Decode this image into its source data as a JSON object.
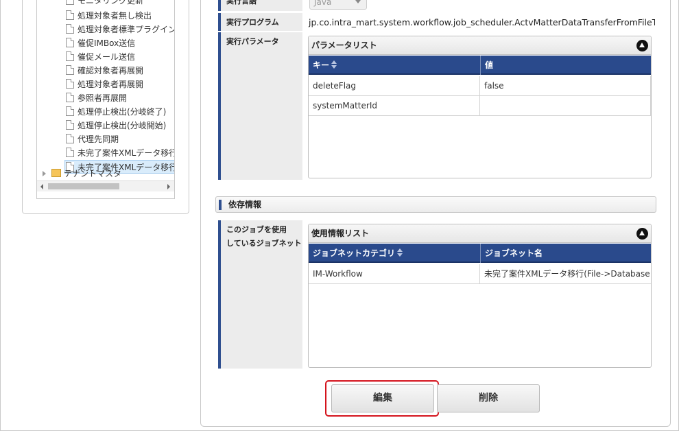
{
  "tree": {
    "items": [
      {
        "label": "モニタリング更新"
      },
      {
        "label": "処理対象者無し検出"
      },
      {
        "label": "処理対象者標準プラグイン用"
      },
      {
        "label": "催促IMBox送信"
      },
      {
        "label": "催促メール送信"
      },
      {
        "label": "確認対象者再展開"
      },
      {
        "label": "処理対象者再展開"
      },
      {
        "label": "参照者再展開"
      },
      {
        "label": "処理停止検出(分岐終了)"
      },
      {
        "label": "処理停止検出(分岐開始)"
      },
      {
        "label": "代理先同期"
      },
      {
        "label": "未完了案件XMLデータ移行"
      },
      {
        "label": "未完了案件XMLデータ移行"
      }
    ],
    "root_label": "テナントマスタ"
  },
  "job": {
    "lang_label": "実行言語",
    "lang_value": "Java",
    "program_label": "実行プログラム",
    "program_value": "jp.co.intra_mart.system.workflow.job_scheduler.ActvMatterDataTransferFromFileToDB",
    "param_label": "実行パラメータ"
  },
  "param_grid": {
    "title": "パラメータリスト",
    "columns": [
      "キー",
      "値"
    ],
    "rows": [
      [
        "deleteFlag",
        "false"
      ],
      [
        "systemMatterId",
        ""
      ]
    ]
  },
  "dependency": {
    "section_title": "依存情報",
    "net_label": "このジョブを使用しているジョブネット",
    "grid_title": "使用情報リスト",
    "columns": [
      "ジョブネットカテゴリ",
      "ジョブネット名"
    ],
    "rows": [
      [
        "IM-Workflow",
        "未完了案件XMLデータ移行(File->Database LO"
      ]
    ]
  },
  "buttons": {
    "edit_label": "編集",
    "delete_label": "削除"
  },
  "colors": {
    "header_blue": "#2a4a8c",
    "highlight_red": "#d4131c"
  }
}
